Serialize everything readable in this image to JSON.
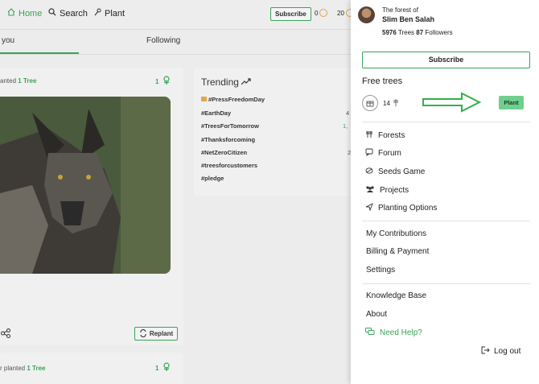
{
  "header": {
    "home": "Home",
    "search": "Search",
    "plant": "Plant",
    "subscribe": "Subscribe",
    "count_a": "0",
    "count_b": "20"
  },
  "tabs": [
    "you",
    "Following"
  ],
  "feed": {
    "post1_meta_prefix": "anted",
    "post1_meta_trees": "1 Tree",
    "post1_count": "1",
    "replant": "Replant",
    "post2_meta_prefix": "r planted",
    "post2_meta_trees": "1 Tree",
    "post2_count": "1"
  },
  "trending": {
    "title": "Trending",
    "items": [
      {
        "tag": "#PressFreedomDay",
        "value": ""
      },
      {
        "tag": "#EarthDay",
        "value": "4"
      },
      {
        "tag": "#TreesForTomorrow",
        "value": "1,"
      },
      {
        "tag": "#Thanksforcoming",
        "value": ""
      },
      {
        "tag": "#NetZeroCitizen",
        "value": "2"
      },
      {
        "tag": "#treesforcustomers",
        "value": ""
      },
      {
        "tag": "#pledge",
        "value": ""
      }
    ]
  },
  "panel": {
    "forest_of": "The forest of",
    "user_name": "Slim Ben Salah",
    "trees_count": "5976",
    "trees_label": "Trees",
    "followers_count": "87",
    "followers_label": "Followers",
    "subscribe": "Subscribe",
    "free_trees": "Free trees",
    "free_count": "14",
    "plant_btn": "Plant",
    "menu1": [
      "Forests",
      "Forum",
      "Seeds Game",
      "Projects",
      "Planting Options"
    ],
    "menu2": [
      "My Contributions",
      "Billing & Payment",
      "Settings"
    ],
    "menu3": [
      "Knowledge Base",
      "About"
    ],
    "help": "Need Help?",
    "logout": "Log out"
  },
  "colors": {
    "accent": "#3aa35a",
    "plant_button": "#6fd08e",
    "arrow": "#2fb24a"
  }
}
